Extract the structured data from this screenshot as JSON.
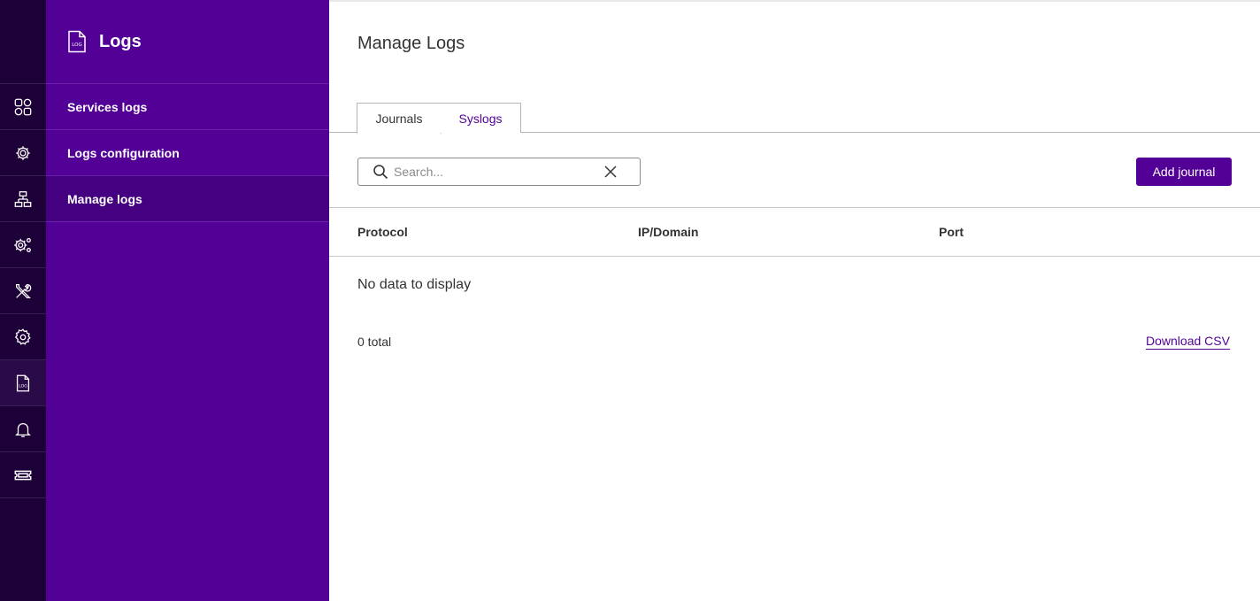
{
  "rail": {
    "items": [
      {
        "icon": "dashboard-icon"
      },
      {
        "icon": "network-gear-icon"
      },
      {
        "icon": "topology-icon"
      },
      {
        "icon": "settings-cogs-icon"
      },
      {
        "icon": "tools-icon"
      },
      {
        "icon": "gear-icon"
      },
      {
        "icon": "log-file-icon"
      },
      {
        "icon": "bell-icon"
      },
      {
        "icon": "ticket-icon"
      }
    ],
    "active_index": 6
  },
  "sidebar": {
    "title": "Logs",
    "title_icon": "log-file-icon",
    "items": [
      {
        "label": "Services logs"
      },
      {
        "label": "Logs configuration"
      },
      {
        "label": "Manage logs"
      }
    ],
    "active_index": 2
  },
  "main": {
    "title": "Manage Logs",
    "tabs": [
      {
        "label": "Journals",
        "active": true
      },
      {
        "label": "Syslogs",
        "active": false
      }
    ],
    "search": {
      "placeholder": "Search...",
      "value": ""
    },
    "add_button": "Add journal",
    "table": {
      "columns": [
        "Protocol",
        "IP/Domain",
        "Port"
      ],
      "rows": [],
      "empty_text": "No data to display"
    },
    "total": "0 total",
    "download": "Download CSV"
  },
  "colors": {
    "rail_bg": "#1e0038",
    "sidebar_bg": "#520096",
    "sidebar_active": "#440080",
    "accent": "#520096"
  }
}
